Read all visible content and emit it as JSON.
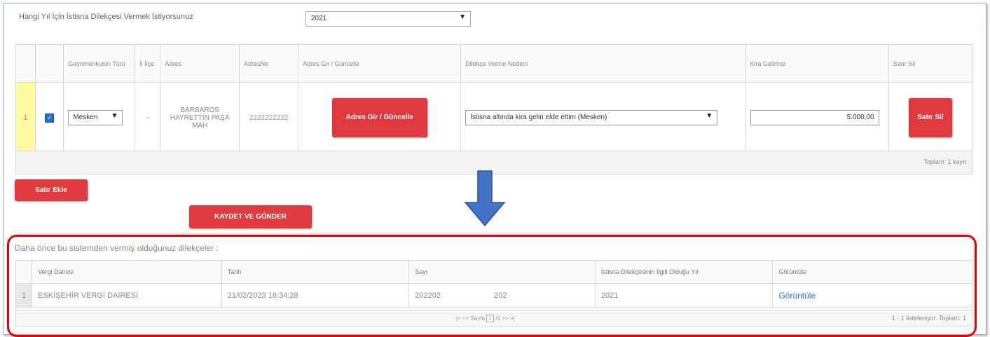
{
  "year_question": {
    "label": "Hangi Yıl İçin İstisna Dilekçesi Vermek İstiyorsunuz",
    "selected": "2021"
  },
  "property_table": {
    "headers": [
      "Gayrimenkulün Türü",
      "İl İlçe",
      "Adres",
      "AdresNo",
      "Adres Gir / Güncelle",
      "Dilekçe Verme Nedeni",
      "Kira Geliriniz",
      "Satır Sil"
    ],
    "row": {
      "number": "1",
      "checked": true,
      "type": "Mesken",
      "il_ilce": "–",
      "address": "BARBAROS HAYRETTİN PAŞA MAH",
      "address_no": "2222222222",
      "address_button": "Adres Gir / Güncelle",
      "reason": "İstisna altında kira geliri elde ettim (Mesken)",
      "rent": "5.000,00",
      "delete_button": "Satır Sil"
    },
    "total": "Toplam: 1 kayıt"
  },
  "add_row_button": "Satır Ekle",
  "save_send_button": "KAYDET VE GÖNDER",
  "previous": {
    "label": "Daha önce bu sistemden  vermiş olduğunuz dilekçeler :",
    "headers": [
      "Vergi Dairesi",
      "Tarih",
      "Sayı",
      "İstisna Dilekçesinin İlgili Olduğu Yıl",
      "Görüntüle"
    ],
    "rows": [
      {
        "number": "1",
        "office": "ESKİŞEHİR VERGİ DAİRESİ",
        "date": "21/02/2023 16:34:28",
        "sayi_a": "202202",
        "sayi_b": "202",
        "year": "2021",
        "view": "Görüntüle"
      }
    ],
    "pager": {
      "page_label": "Sayfa",
      "page": "1",
      "of": "/1"
    },
    "records": "1 - 1 listeleniyor. Toplam: 1"
  },
  "colors": {
    "red": "#e03a3e",
    "arrow": "#4472c4",
    "highlight": "#fff9a0",
    "frame_red": "#ee0000"
  }
}
